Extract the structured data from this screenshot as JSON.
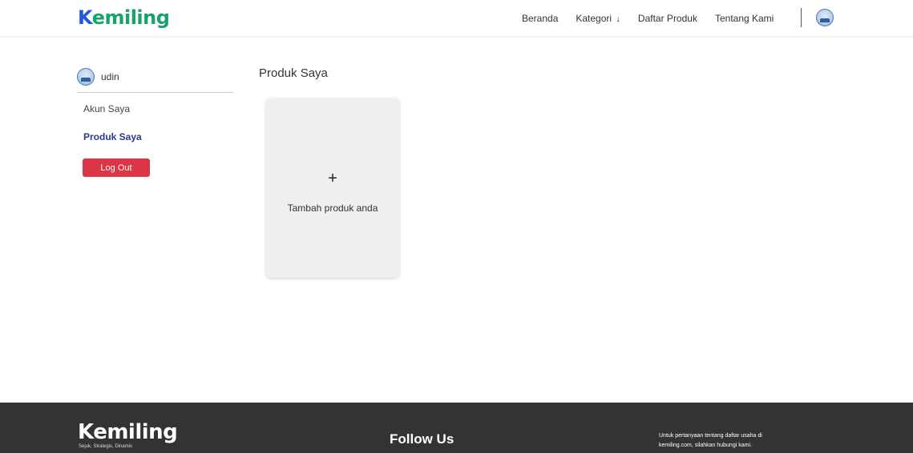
{
  "header": {
    "brand_k": "K",
    "brand_rest": "emiling",
    "nav": {
      "beranda": "Beranda",
      "kategori": "Kategori",
      "kategori_arrow": "↓",
      "daftar_produk": "Daftar Produk",
      "tentang_kami": "Tentang Kami"
    },
    "avatar_icon": "user-avatar-icon"
  },
  "sidebar": {
    "username": "udin",
    "items": [
      {
        "label": "Akun Saya",
        "active": false
      },
      {
        "label": "Produk Saya",
        "active": true
      }
    ],
    "logout_label": "Log Out"
  },
  "main": {
    "title": "Produk Saya",
    "add_card": {
      "icon": "+",
      "label": "Tambah produk anda"
    }
  },
  "footer": {
    "brand": "Kemiling",
    "tagline": "Sejuk, Strategis, Dinamis",
    "follow": "Follow Us",
    "contact_line1": "Untuk pertanyaan tentang daftar usaha di",
    "contact_line2": "kemiling.com, silahkan hubungi kami."
  },
  "colors": {
    "brand_blue": "#1f5bd6",
    "brand_green": "#17a36a",
    "logout_red": "#dc3545",
    "active_link": "#2b3a8c",
    "footer_bg": "#333333"
  }
}
